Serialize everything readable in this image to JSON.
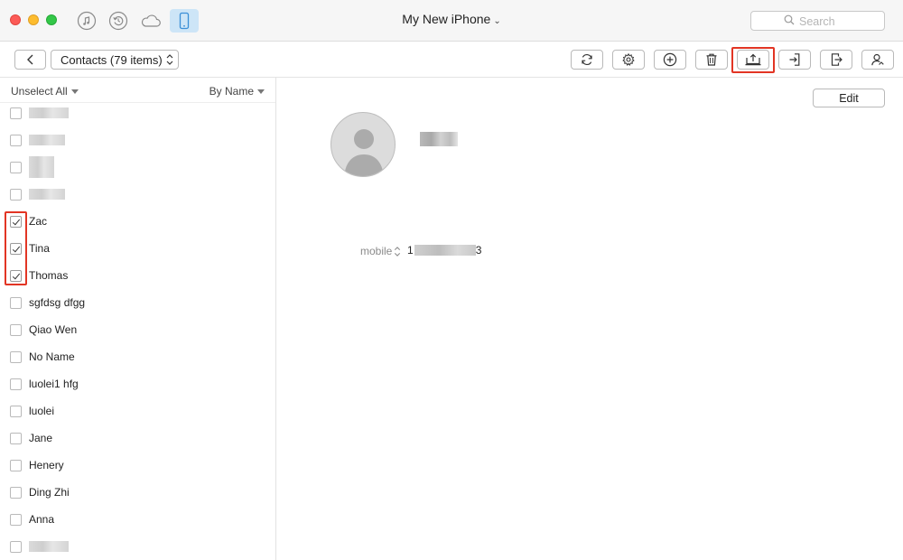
{
  "window": {
    "title": "My New iPhone",
    "title_icon": "chevron-down-icon",
    "traffic_lights": {
      "close": "#fc5b57",
      "minimize": "#fdbc2e",
      "maximize": "#33c748"
    }
  },
  "nav_icons": [
    {
      "name": "itunes-music-icon",
      "active": false
    },
    {
      "name": "backup-restore-icon",
      "active": false
    },
    {
      "name": "icloud-icon",
      "active": false
    },
    {
      "name": "iphone-device-icon",
      "active": true
    }
  ],
  "search": {
    "placeholder": "Search"
  },
  "toolbar": {
    "category_label": "Contacts (79 items)",
    "buttons": [
      {
        "name": "refresh-icon"
      },
      {
        "name": "settings-gear-icon"
      },
      {
        "name": "add-icon"
      },
      {
        "name": "delete-trash-icon"
      },
      {
        "name": "export-to-computer-icon",
        "highlighted": true
      },
      {
        "name": "import-icon"
      },
      {
        "name": "send-to-device-icon"
      },
      {
        "name": "merge-contacts-icon"
      }
    ],
    "highlight_color": "#e23524"
  },
  "sidebar": {
    "unselect_all": "Unselect All",
    "sort": "By Name",
    "contacts": [
      {
        "name": "",
        "checked": false,
        "redacted": true
      },
      {
        "name": "",
        "checked": false,
        "redacted": true
      },
      {
        "name": "",
        "checked": false,
        "redacted": true
      },
      {
        "name": "",
        "checked": false,
        "redacted": true
      },
      {
        "name": "Zac",
        "checked": true
      },
      {
        "name": "Tina",
        "checked": true
      },
      {
        "name": "Thomas",
        "checked": true
      },
      {
        "name": "sgfdsg dfgg",
        "checked": false
      },
      {
        "name": "Qiao Wen",
        "checked": false
      },
      {
        "name": "No Name",
        "checked": false
      },
      {
        "name": "luolei1 hfg",
        "checked": false
      },
      {
        "name": "luolei",
        "checked": false
      },
      {
        "name": "Jane",
        "checked": false
      },
      {
        "name": "Henery",
        "checked": false
      },
      {
        "name": "Ding Zhi",
        "checked": false
      },
      {
        "name": "Anna",
        "checked": false
      },
      {
        "name": "",
        "checked": false,
        "redacted": true
      }
    ]
  },
  "detail": {
    "edit_label": "Edit",
    "avatar_icon": "contact-avatar-placeholder-icon",
    "phone": {
      "label": "mobile",
      "value_prefix": "1",
      "value_suffix": "3"
    }
  }
}
